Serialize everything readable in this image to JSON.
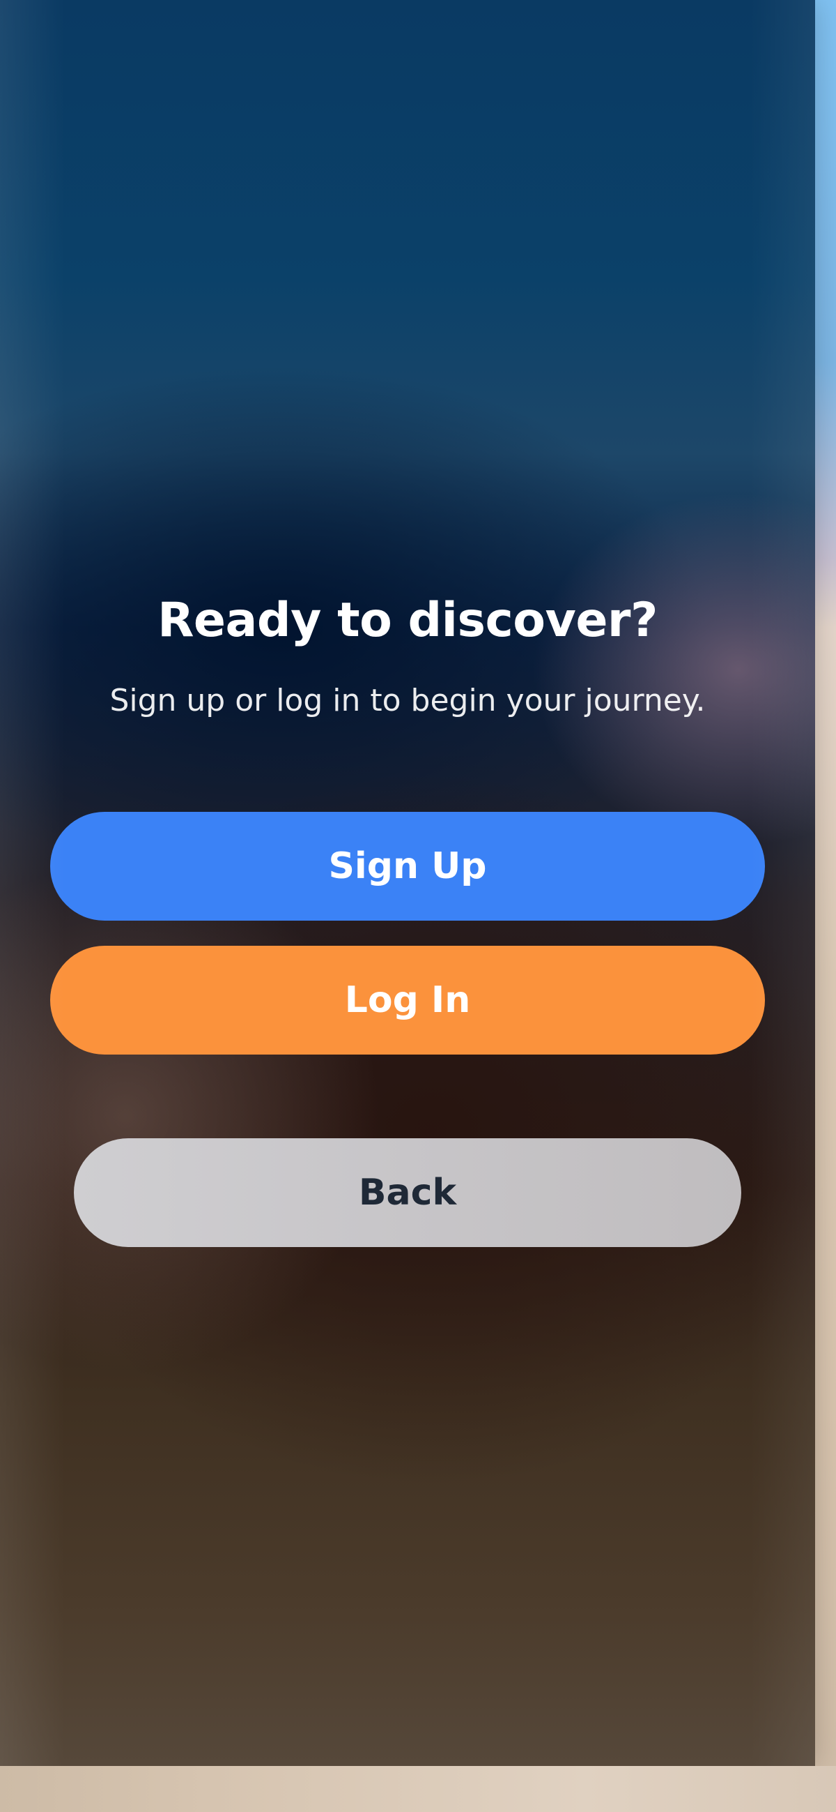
{
  "screen": {
    "title": "Ready to discover?",
    "subtitle": "Sign up or log in to begin your journey."
  },
  "actions": {
    "signup_label": "Sign Up",
    "login_label": "Log In",
    "back_label": "Back"
  },
  "colors": {
    "signup": "#3b82f6",
    "login": "#fb923c",
    "back": "#c7c5c8",
    "back_text": "#1f2937"
  }
}
